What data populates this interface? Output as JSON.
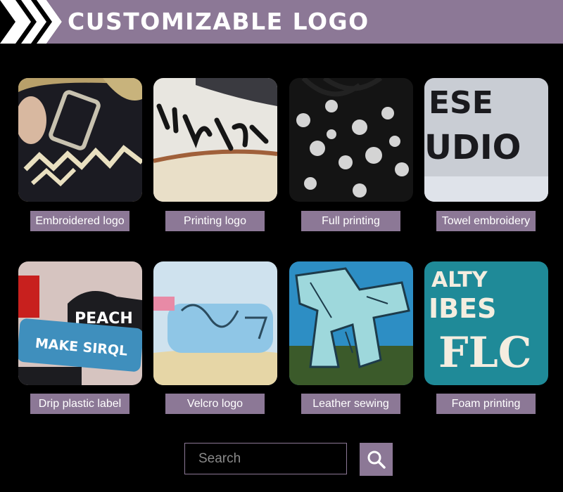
{
  "header": {
    "title": "CUSTOMIZABLE LOGO"
  },
  "colors": {
    "accent": "#8c7896",
    "background": "#000000",
    "text": "#ffffff"
  },
  "products": [
    {
      "label": "Embroidered logo",
      "icon": "embroidered-logo-image"
    },
    {
      "label": "Printing logo",
      "icon": "printing-logo-image"
    },
    {
      "label": "Full printing",
      "icon": "full-printing-image"
    },
    {
      "label": "Towel embroidery",
      "icon": "towel-embroidery-image"
    },
    {
      "label": "Drip plastic label",
      "icon": "drip-plastic-label-image"
    },
    {
      "label": "Velcro logo",
      "icon": "velcro-logo-image"
    },
    {
      "label": "Leather sewing",
      "icon": "leather-sewing-image"
    },
    {
      "label": "Foam printing",
      "icon": "foam-printing-image"
    }
  ],
  "search": {
    "placeholder": "Search",
    "value": "",
    "button_icon": "search-icon"
  }
}
